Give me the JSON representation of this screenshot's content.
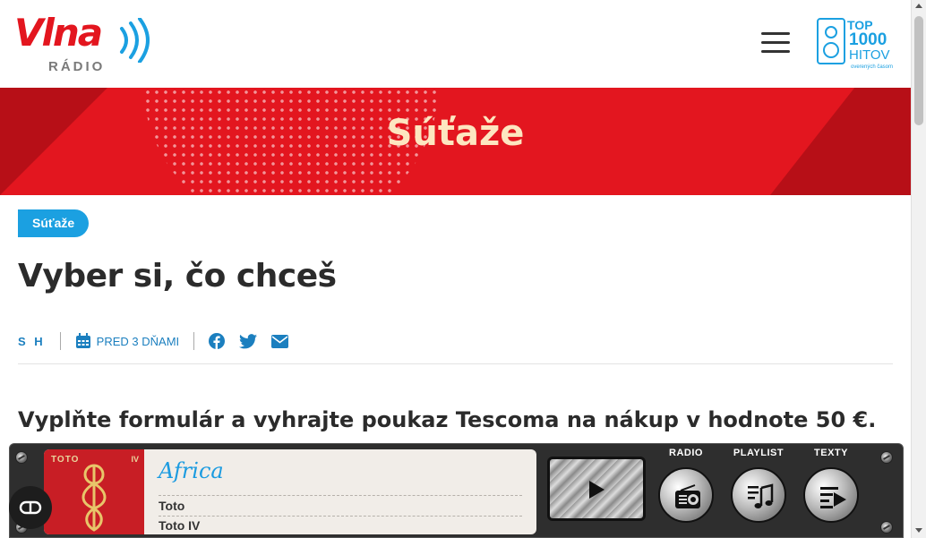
{
  "header": {
    "logo_text": "Vlna",
    "logo_sub": "RÁDIO",
    "top1000": {
      "top": "TOP",
      "num": "1000",
      "hitov": "HITOV",
      "tagline": "overených časom"
    }
  },
  "banner": {
    "title": "Súťaže"
  },
  "article": {
    "tag": "Súťaže",
    "title": "Vyber si, čo chceš",
    "author": "S H",
    "date": "PRED 3 DŇAMI",
    "lead": "Vyplňte formulár a vyhrajte poukaz Tescoma na nákup v hodnote 50 €."
  },
  "player": {
    "song": "Africa",
    "artist": "Toto",
    "album": "Toto IV",
    "cover_title": "TOTO",
    "cover_num": "IV",
    "buttons": {
      "radio": "RADIO",
      "playlist": "PLAYLIST",
      "texty": "TEXTY"
    }
  },
  "colors": {
    "brand_red": "#e3161f",
    "accent_blue": "#1ba0e1",
    "banner_title": "#fde6c0"
  }
}
